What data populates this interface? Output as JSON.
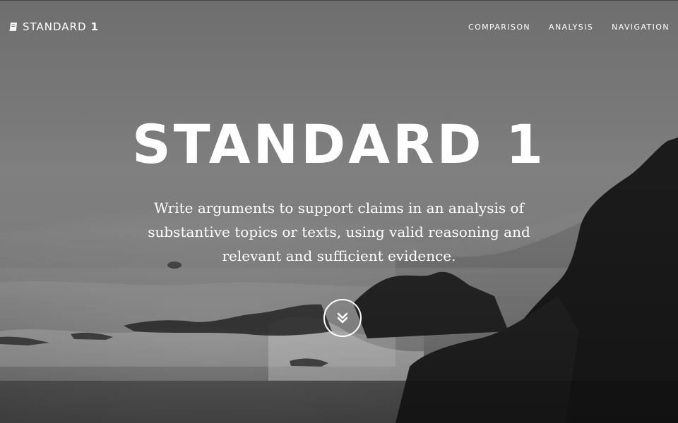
{
  "navbar": {
    "brand_name": "STANDARD",
    "brand_number": "1",
    "brand_icon": "book-icon",
    "links": [
      {
        "label": "COMPARISON"
      },
      {
        "label": "ANALYSIS"
      },
      {
        "label": "NAVIGATION"
      }
    ]
  },
  "hero": {
    "title": "STANDARD 1",
    "subtitle": "Write arguments to support claims in an analysis of substantive topics or texts, using valid reasoning and relevant and sufficient evidence.",
    "scroll_icon": "double-chevron-down-icon"
  },
  "colors": {
    "text": "#ffffff",
    "background": "#7a7a7a",
    "rock": "#1f1f1f"
  }
}
